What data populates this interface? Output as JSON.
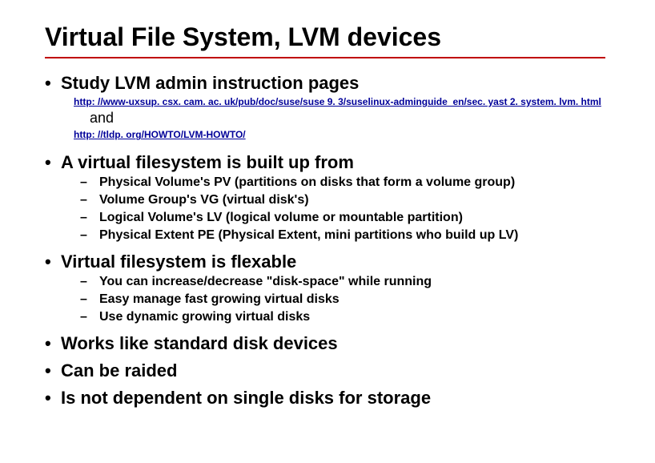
{
  "title": "Virtual File System, LVM devices",
  "sections": [
    {
      "label": "Study LVM admin instruction pages",
      "links": {
        "url1": "http: //www-uxsup. csx. cam. ac. uk/pub/doc/suse/suse 9. 3/suselinux-adminguide_en/sec. yast 2. system. lvm. html",
        "and": "and",
        "url2": "http: //tldp. org/HOWTO/LVM-HOWTO/"
      }
    },
    {
      "label": "A virtual filesystem is built up from",
      "items": [
        "Physical Volume's PV (partitions on disks that form a volume group)",
        "Volume Group's VG (virtual disk's)",
        "Logical Volume's LV (logical volume or mountable partition)",
        "Physical Extent PE (Physical Extent, mini partitions who build up LV)"
      ]
    },
    {
      "label": "Virtual filesystem is flexable",
      "items": [
        "You can increase/decrease \"disk-space\" while running",
        "Easy manage fast growing virtual disks",
        "Use dynamic growing virtual disks"
      ]
    },
    {
      "label": "Works like standard disk devices"
    },
    {
      "label": "Can be raided"
    },
    {
      "label": "Is not dependent on single disks for storage"
    }
  ]
}
